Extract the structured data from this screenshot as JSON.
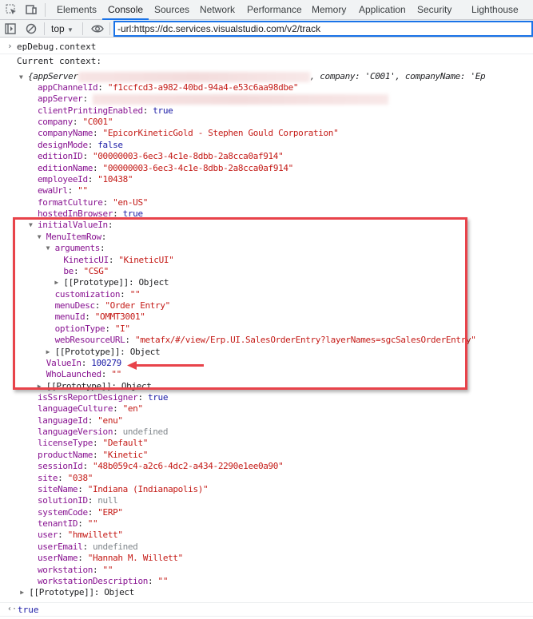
{
  "tabs": [
    "Elements",
    "Console",
    "Sources",
    "Network",
    "Performance",
    "Memory",
    "Application",
    "Security",
    "Lighthouse"
  ],
  "active_tab": "Console",
  "filter": {
    "context": "top",
    "value": "-url:https://dc.services.visualstudio.com/v2/track"
  },
  "input_command": "epDebug.context",
  "log_text": "Current context:",
  "summary": {
    "start": "{appServer",
    "rest": ", company: 'C001', companyName: 'Ep"
  },
  "rows": [
    {
      "i": 0,
      "k": "appChannelId",
      "v": "\"f1ccfcd3-a982-40bd-94a4-e53c6aa98dbe\"",
      "t": "s"
    },
    {
      "i": 0,
      "k": "appServer",
      "v": "",
      "t": "blur"
    },
    {
      "i": 0,
      "k": "clientPrintingEnabled",
      "v": "true",
      "t": "n"
    },
    {
      "i": 0,
      "k": "company",
      "v": "\"C001\"",
      "t": "s"
    },
    {
      "i": 0,
      "k": "companyName",
      "v": "\"EpicorKineticGold - Stephen Gould Corporation\"",
      "t": "s"
    },
    {
      "i": 0,
      "k": "designMode",
      "v": "false",
      "t": "n"
    },
    {
      "i": 0,
      "k": "editionID",
      "v": "\"00000003-6ec3-4c1e-8dbb-2a8cca0af914\"",
      "t": "s"
    },
    {
      "i": 0,
      "k": "editionName",
      "v": "\"00000003-6ec3-4c1e-8dbb-2a8cca0af914\"",
      "t": "s"
    },
    {
      "i": 0,
      "k": "employeeId",
      "v": "\"10438\"",
      "t": "s"
    },
    {
      "i": 0,
      "k": "ewaUrl",
      "v": "\"\"",
      "t": "s"
    },
    {
      "i": 0,
      "k": "formatCulture",
      "v": "\"en-US\"",
      "t": "s"
    },
    {
      "i": 0,
      "k": "hostedInBrowser",
      "v": "true",
      "t": "n"
    },
    {
      "i": 0,
      "k": "initialValueIn",
      "v": "",
      "t": "n",
      "a": "down"
    },
    {
      "i": 1,
      "k": "MenuItemRow",
      "v": "",
      "t": "n",
      "a": "down"
    },
    {
      "i": 2,
      "k": "arguments",
      "v": "",
      "t": "n",
      "a": "down"
    },
    {
      "i": 3,
      "k": "KineticUI",
      "v": "\"KineticUI\"",
      "t": "s"
    },
    {
      "i": 3,
      "k": "be",
      "v": "\"CSG\"",
      "t": "s"
    },
    {
      "i": 3,
      "k": "[[Prototype]]",
      "v": "Object",
      "t": "o",
      "a": "right",
      "kc": "o"
    },
    {
      "i": 2,
      "k": "customization",
      "v": "\"\"",
      "t": "s"
    },
    {
      "i": 2,
      "k": "menuDesc",
      "v": "\"Order Entry\"",
      "t": "s"
    },
    {
      "i": 2,
      "k": "menuId",
      "v": "\"OMMT3001\"",
      "t": "s"
    },
    {
      "i": 2,
      "k": "optionType",
      "v": "\"I\"",
      "t": "s"
    },
    {
      "i": 2,
      "k": "webResourceURL",
      "v": "\"metafx/#/view/Erp.UI.SalesOrderEntry?layerNames=sgcSalesOrderEntry\"",
      "t": "s"
    },
    {
      "i": 2,
      "k": "[[Prototype]]",
      "v": "Object",
      "t": "o",
      "a": "right",
      "kc": "o"
    },
    {
      "i": 1,
      "k": "ValueIn",
      "v": "100279",
      "t": "n"
    },
    {
      "i": 1,
      "k": "WhoLaunched",
      "v": "\"\"",
      "t": "s"
    },
    {
      "i": 1,
      "k": "[[Prototype]]",
      "v": "Object",
      "t": "o",
      "a": "right",
      "kc": "o"
    },
    {
      "i": 0,
      "k": "isSsrsReportDesigner",
      "v": "true",
      "t": "n"
    },
    {
      "i": 0,
      "k": "languageCulture",
      "v": "\"en\"",
      "t": "s"
    },
    {
      "i": 0,
      "k": "languageId",
      "v": "\"enu\"",
      "t": "s"
    },
    {
      "i": 0,
      "k": "languageVersion",
      "v": "undefined",
      "t": "u"
    },
    {
      "i": 0,
      "k": "licenseType",
      "v": "\"Default\"",
      "t": "s"
    },
    {
      "i": 0,
      "k": "productName",
      "v": "\"Kinetic\"",
      "t": "s"
    },
    {
      "i": 0,
      "k": "sessionId",
      "v": "\"48b059c4-a2c6-4dc2-a434-2290e1ee0a90\"",
      "t": "s"
    },
    {
      "i": 0,
      "k": "site",
      "v": "\"038\"",
      "t": "s"
    },
    {
      "i": 0,
      "k": "siteName",
      "v": "\"Indiana (Indianapolis)\"",
      "t": "s"
    },
    {
      "i": 0,
      "k": "solutionID",
      "v": "null",
      "t": "u"
    },
    {
      "i": 0,
      "k": "systemCode",
      "v": "\"ERP\"",
      "t": "s"
    },
    {
      "i": 0,
      "k": "tenantID",
      "v": "\"\"",
      "t": "s"
    },
    {
      "i": 0,
      "k": "user",
      "v": "\"hmwillett\"",
      "t": "s"
    },
    {
      "i": 0,
      "k": "userEmail",
      "v": "undefined",
      "t": "u"
    },
    {
      "i": 0,
      "k": "userName",
      "v": "\"Hannah M. Willett\"",
      "t": "s"
    },
    {
      "i": 0,
      "k": "workstation",
      "v": "\"\"",
      "t": "s"
    },
    {
      "i": 0,
      "k": "workstationDescription",
      "v": "\"\"",
      "t": "s"
    },
    {
      "i": -1,
      "k": "[[Prototype]]",
      "v": "Object",
      "t": "o",
      "a": "right",
      "kc": "o"
    }
  ],
  "result": "true",
  "colors": {
    "highlight": "#e8434a",
    "accent": "#1a73e8"
  }
}
